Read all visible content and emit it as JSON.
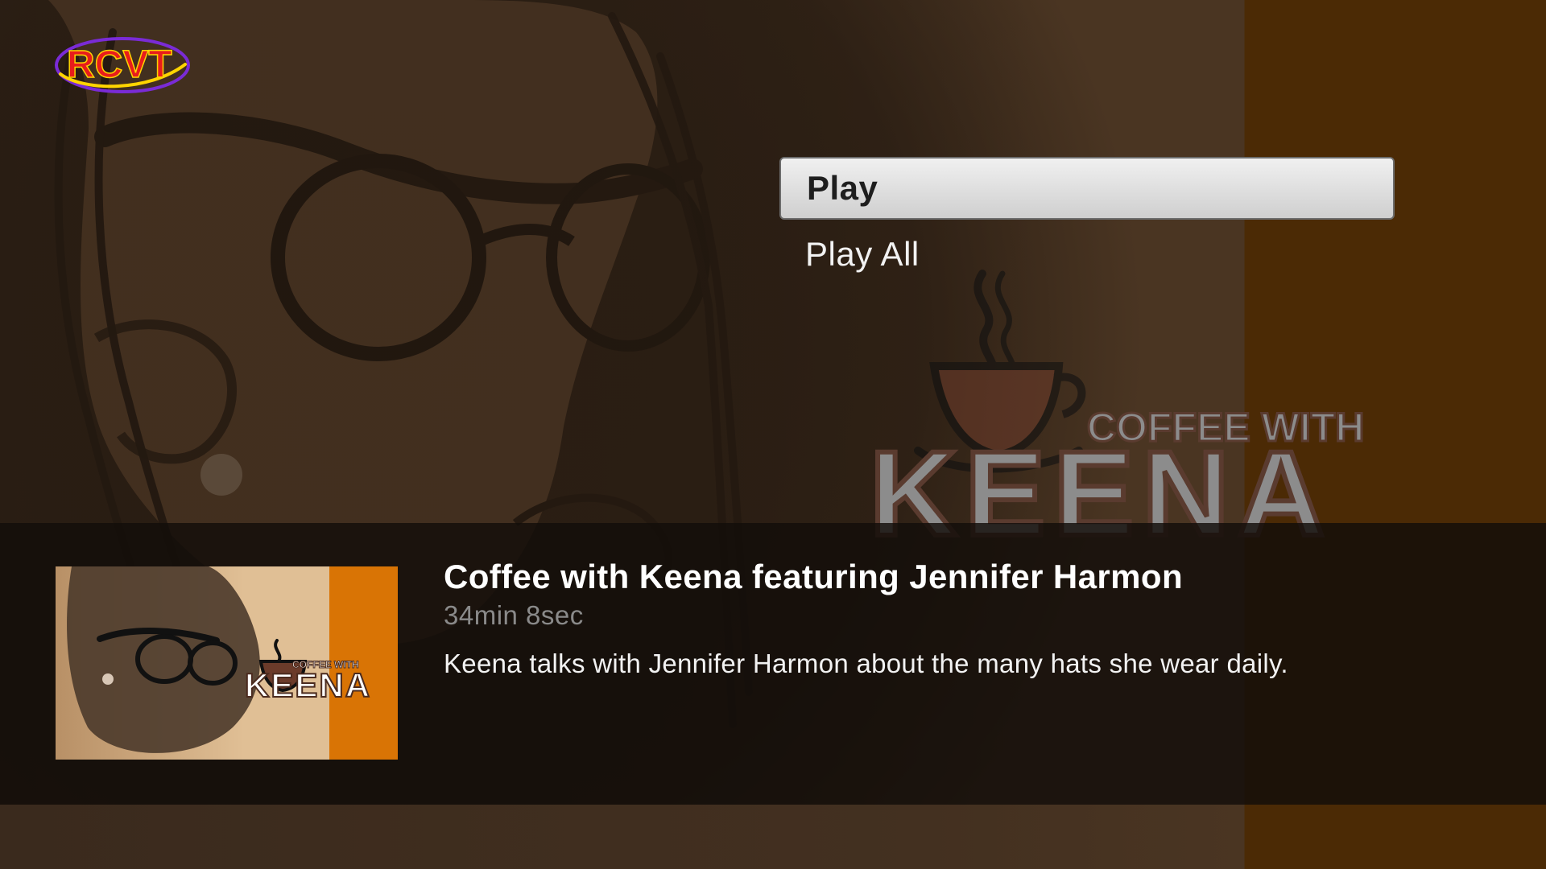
{
  "app": {
    "logo_text": "RCVT",
    "colors": {
      "logo_red": "#e81c1c",
      "logo_ring": "#7a2bd6",
      "logo_yellow": "#ffd400",
      "accent_orange": "#d97405",
      "panel": "#120e0a",
      "brown_background": "#3b2a1b"
    }
  },
  "background_art": {
    "brand_line1": "COFFEE WITH",
    "brand_line2": "KEENA"
  },
  "menu": {
    "items": [
      {
        "label": "Play",
        "selected": true
      },
      {
        "label": "Play All",
        "selected": false
      }
    ]
  },
  "details": {
    "title": "Coffee with Keena featuring Jennifer Harmon",
    "duration": "34min 8sec",
    "description": "Keena talks with Jennifer Harmon about the many hats she wear daily.",
    "thumbnail": {
      "brand_line1": "COFFEE WITH",
      "brand_line2": "KEENA"
    }
  }
}
